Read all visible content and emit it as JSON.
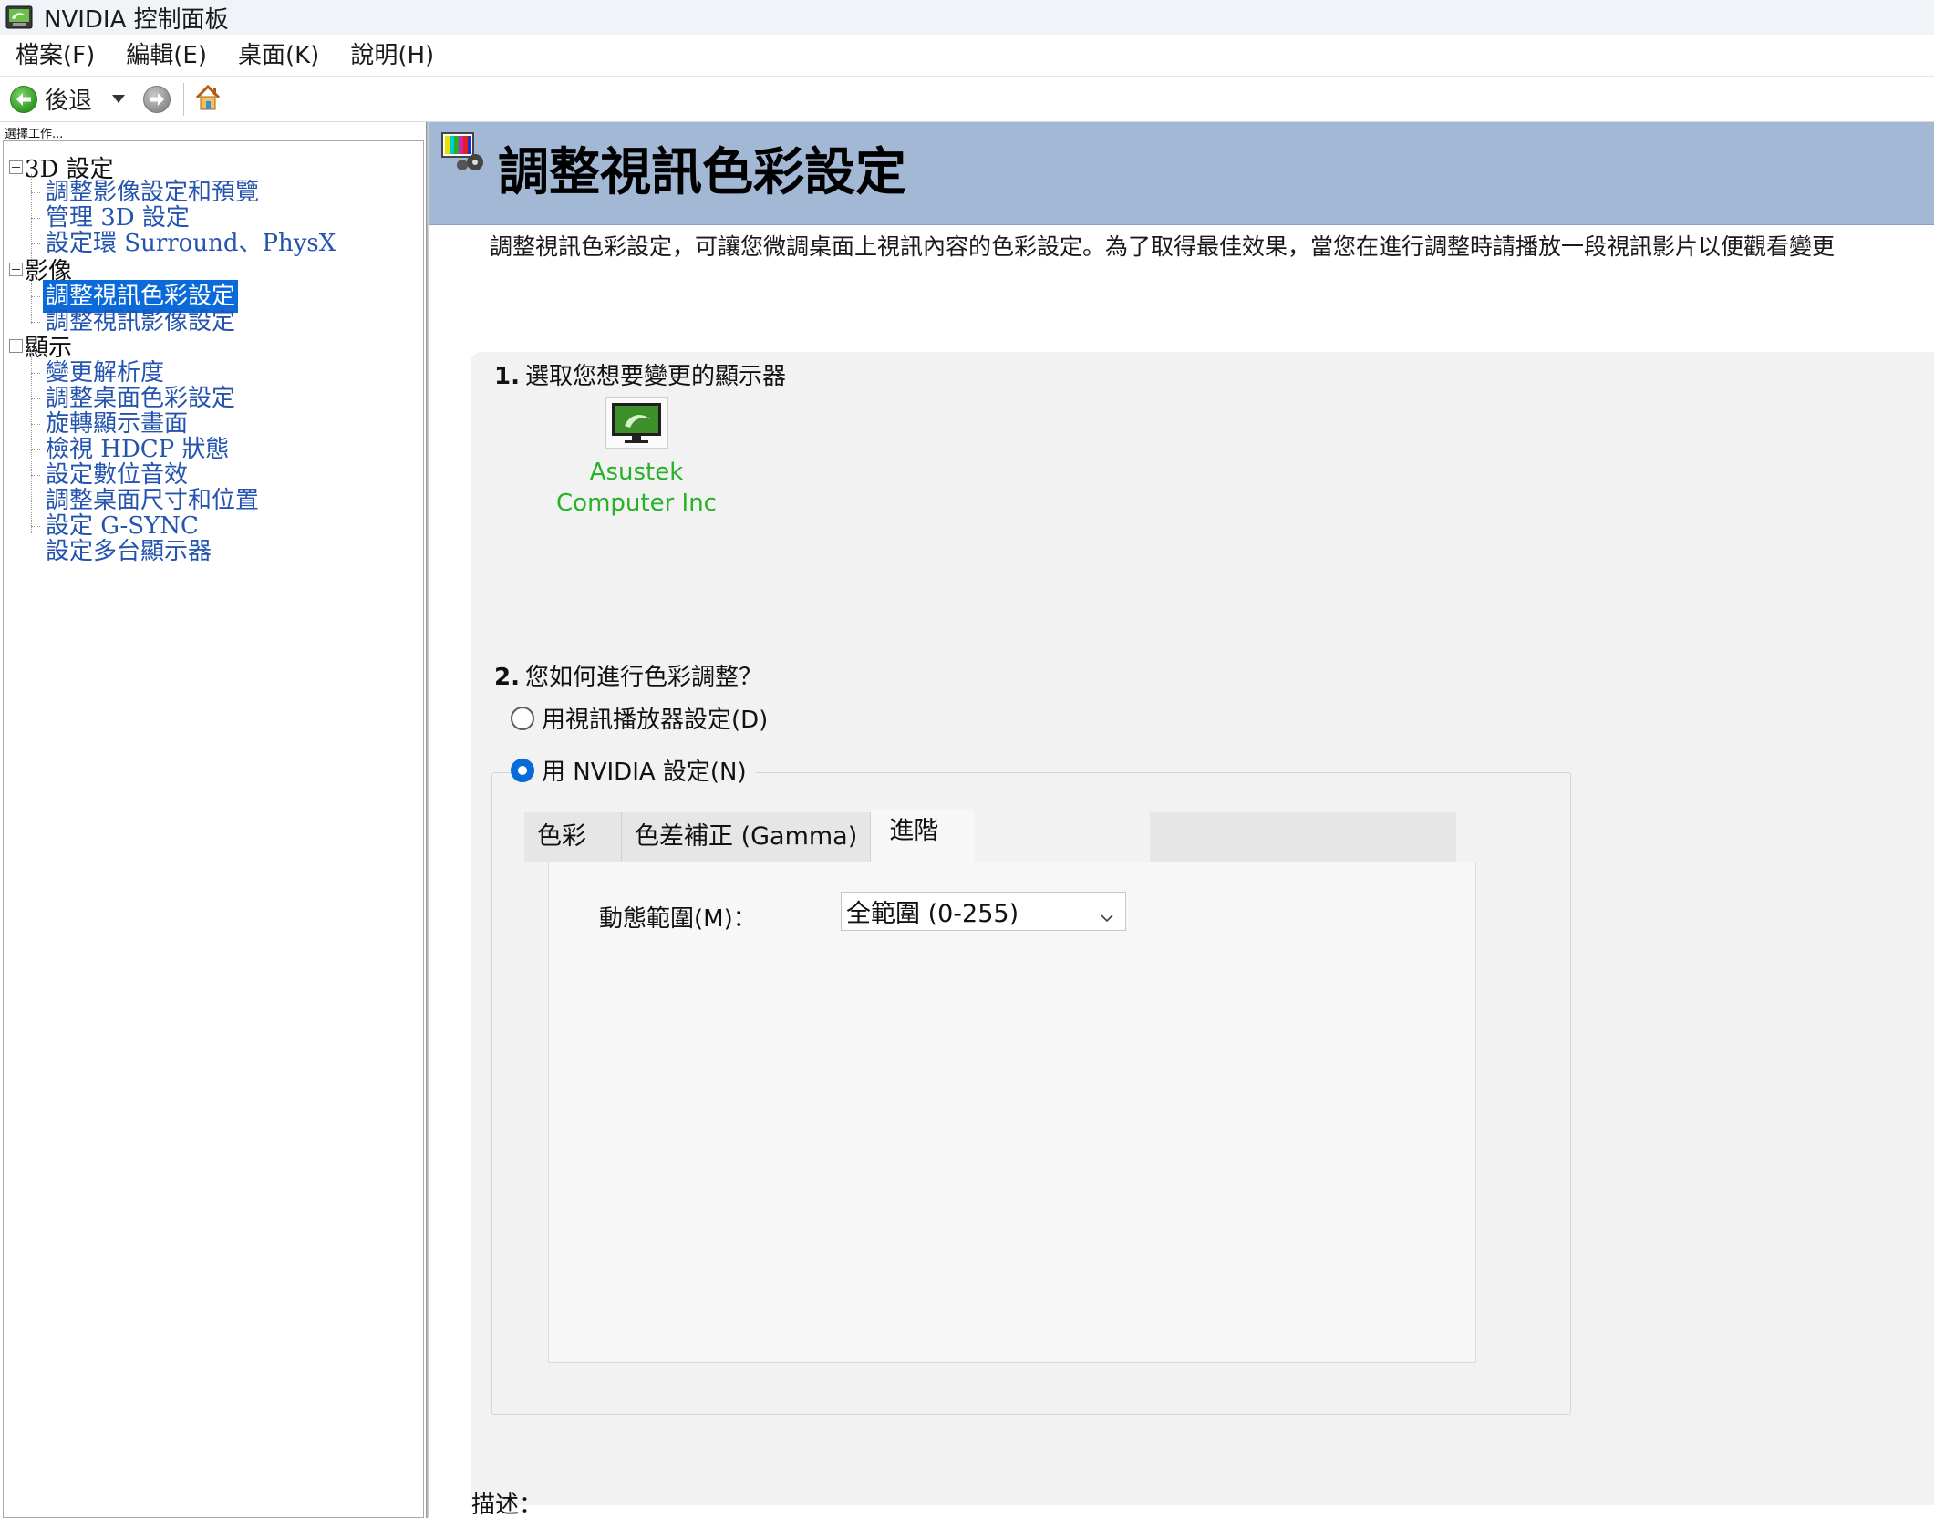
{
  "window": {
    "title": "NVIDIA 控制面板"
  },
  "menu": {
    "items": [
      "檔案(F)",
      "編輯(E)",
      "桌面(K)",
      "說明(H)"
    ]
  },
  "toolbar": {
    "back_label": "後退"
  },
  "sidebar": {
    "caption": "選擇工作...",
    "groups": [
      {
        "label": "3D 設定",
        "items": [
          "調整影像設定和預覽",
          "管理 3D 設定",
          "設定環 Surround、PhysX"
        ]
      },
      {
        "label": "影像",
        "items": [
          "調整視訊色彩設定",
          "調整視訊影像設定"
        ]
      },
      {
        "label": "顯示",
        "items": [
          "變更解析度",
          "調整桌面色彩設定",
          "旋轉顯示畫面",
          "檢視 HDCP 狀態",
          "設定數位音效",
          "調整桌面尺寸和位置",
          "設定 G-SYNC",
          "設定多台顯示器"
        ]
      }
    ],
    "selected": "調整視訊色彩設定"
  },
  "page": {
    "title": "調整視訊色彩設定",
    "intro": "調整視訊色彩設定，可讓您微調桌面上視訊內容的色彩設定。為了取得最佳效果，當您在進行調整時請播放一段視訊影片以便觀看變更",
    "step1": {
      "number": "1.",
      "heading": "選取您想要變更的顯示器"
    },
    "monitor": {
      "line1": "Asustek",
      "line2": "Computer Inc"
    },
    "step2": {
      "number": "2.",
      "heading": "您如何進行色彩調整？"
    },
    "radio_player": "用視訊播放器設定(D)",
    "radio_nvidia": "用 NVIDIA 設定(N)",
    "radio_selected": "nvidia",
    "tabs": [
      "色彩",
      "色差補正 (Gamma)",
      "進階"
    ],
    "active_tab": "進階",
    "dynamic_range_label": "動態範圍(M)：",
    "dynamic_range_value": "全範圍 (0-255)",
    "description_label": "描述："
  },
  "colors": {
    "header_band": "#a2b8d5",
    "link_blue": "#2454b0",
    "selection": "#0a6ad9",
    "monitor_green": "#27b227"
  }
}
